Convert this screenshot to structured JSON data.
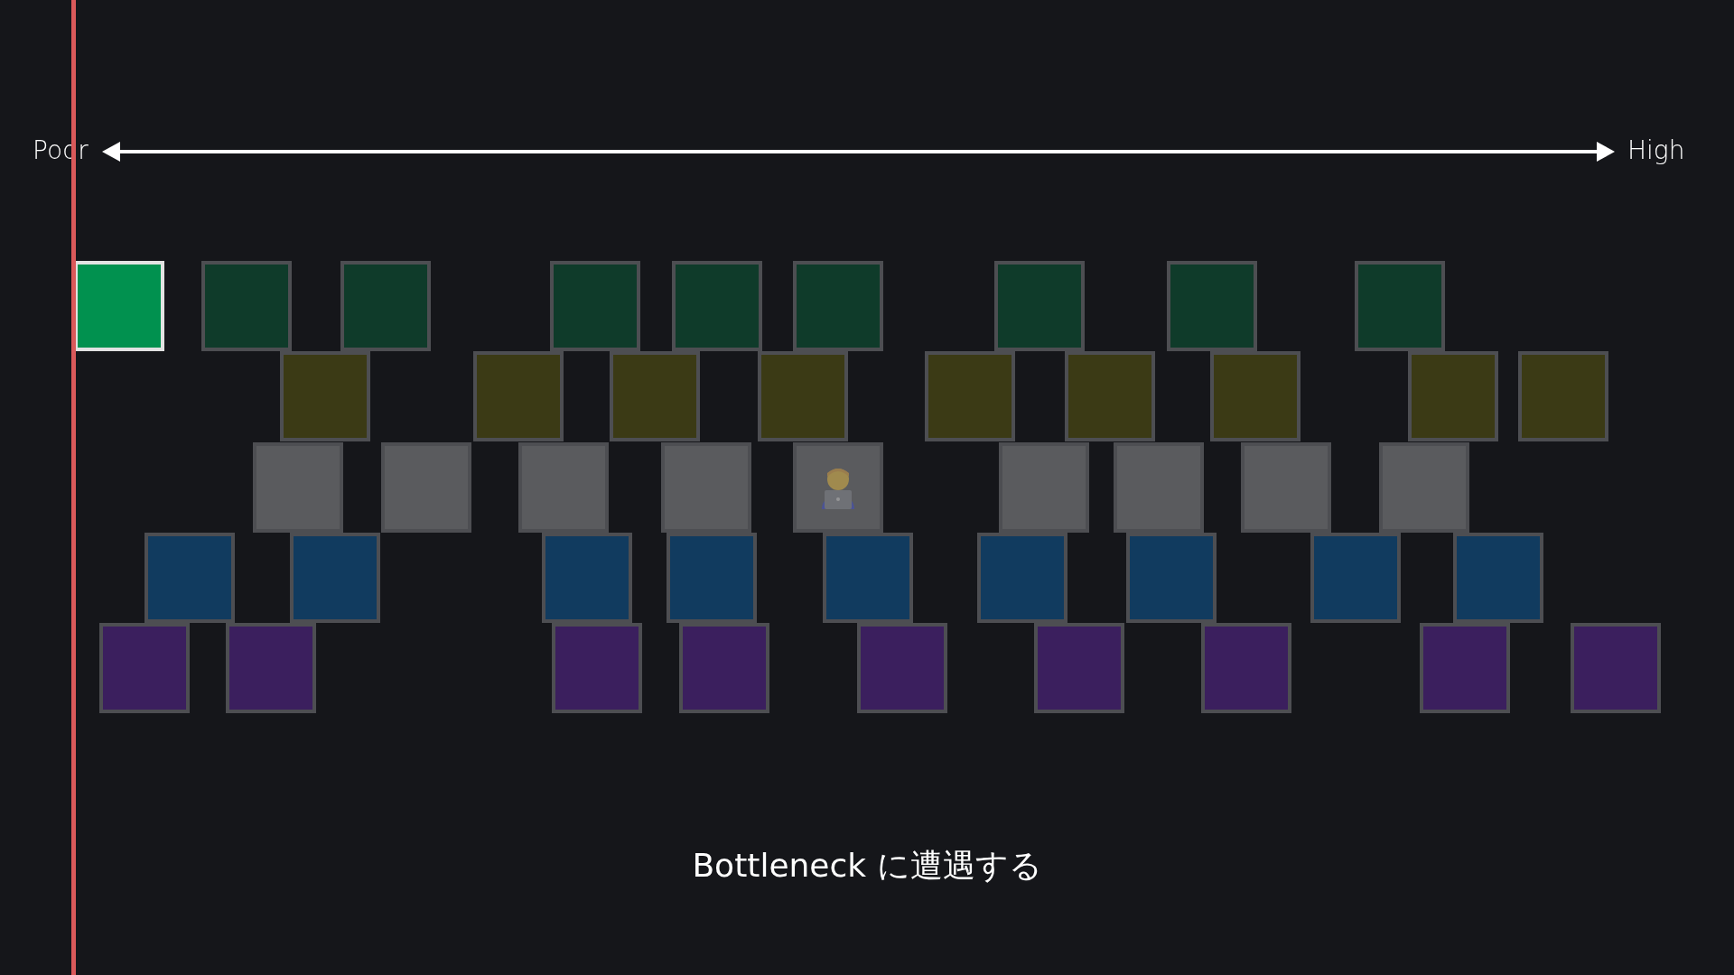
{
  "scale": {
    "low_label": "Poor",
    "high_label": "High"
  },
  "rows": [
    {
      "color": "#0f3b2a",
      "blocks": [
        {
          "selected": true,
          "worker": false
        },
        {
          "selected": false,
          "worker": false
        },
        {
          "selected": false,
          "worker": false
        },
        {
          "selected": false,
          "worker": false
        },
        {
          "selected": false,
          "worker": false
        },
        {
          "selected": false,
          "worker": false
        },
        {
          "selected": false,
          "worker": false
        },
        {
          "selected": false,
          "worker": false
        },
        {
          "selected": false,
          "worker": false
        }
      ]
    },
    {
      "color": "#3b3a15",
      "blocks": [
        {
          "selected": false,
          "worker": false
        },
        {
          "selected": false,
          "worker": false
        },
        {
          "selected": false,
          "worker": false
        },
        {
          "selected": false,
          "worker": false
        },
        {
          "selected": false,
          "worker": false
        },
        {
          "selected": false,
          "worker": false
        },
        {
          "selected": false,
          "worker": false
        },
        {
          "selected": false,
          "worker": false
        },
        {
          "selected": false,
          "worker": false
        }
      ]
    },
    {
      "color": "#5a5b5e",
      "blocks": [
        {
          "selected": false,
          "worker": false
        },
        {
          "selected": false,
          "worker": false
        },
        {
          "selected": false,
          "worker": false
        },
        {
          "selected": false,
          "worker": false
        },
        {
          "selected": false,
          "worker": true
        },
        {
          "selected": false,
          "worker": false
        },
        {
          "selected": false,
          "worker": false
        },
        {
          "selected": false,
          "worker": false
        },
        {
          "selected": false,
          "worker": false
        }
      ]
    },
    {
      "color": "#113b5f",
      "blocks": [
        {
          "selected": false,
          "worker": false
        },
        {
          "selected": false,
          "worker": false
        },
        {
          "selected": false,
          "worker": false
        },
        {
          "selected": false,
          "worker": false
        },
        {
          "selected": false,
          "worker": false
        },
        {
          "selected": false,
          "worker": false
        },
        {
          "selected": false,
          "worker": false
        },
        {
          "selected": false,
          "worker": false
        },
        {
          "selected": false,
          "worker": false
        }
      ]
    },
    {
      "color": "#3b1f5e",
      "blocks": [
        {
          "selected": false,
          "worker": false
        },
        {
          "selected": false,
          "worker": false
        },
        {
          "selected": false,
          "worker": false
        },
        {
          "selected": false,
          "worker": false
        },
        {
          "selected": false,
          "worker": false
        },
        {
          "selected": false,
          "worker": false
        },
        {
          "selected": false,
          "worker": false
        },
        {
          "selected": false,
          "worker": false
        },
        {
          "selected": false,
          "worker": false
        }
      ]
    }
  ],
  "caption": "Bottleneck に遭遇する"
}
